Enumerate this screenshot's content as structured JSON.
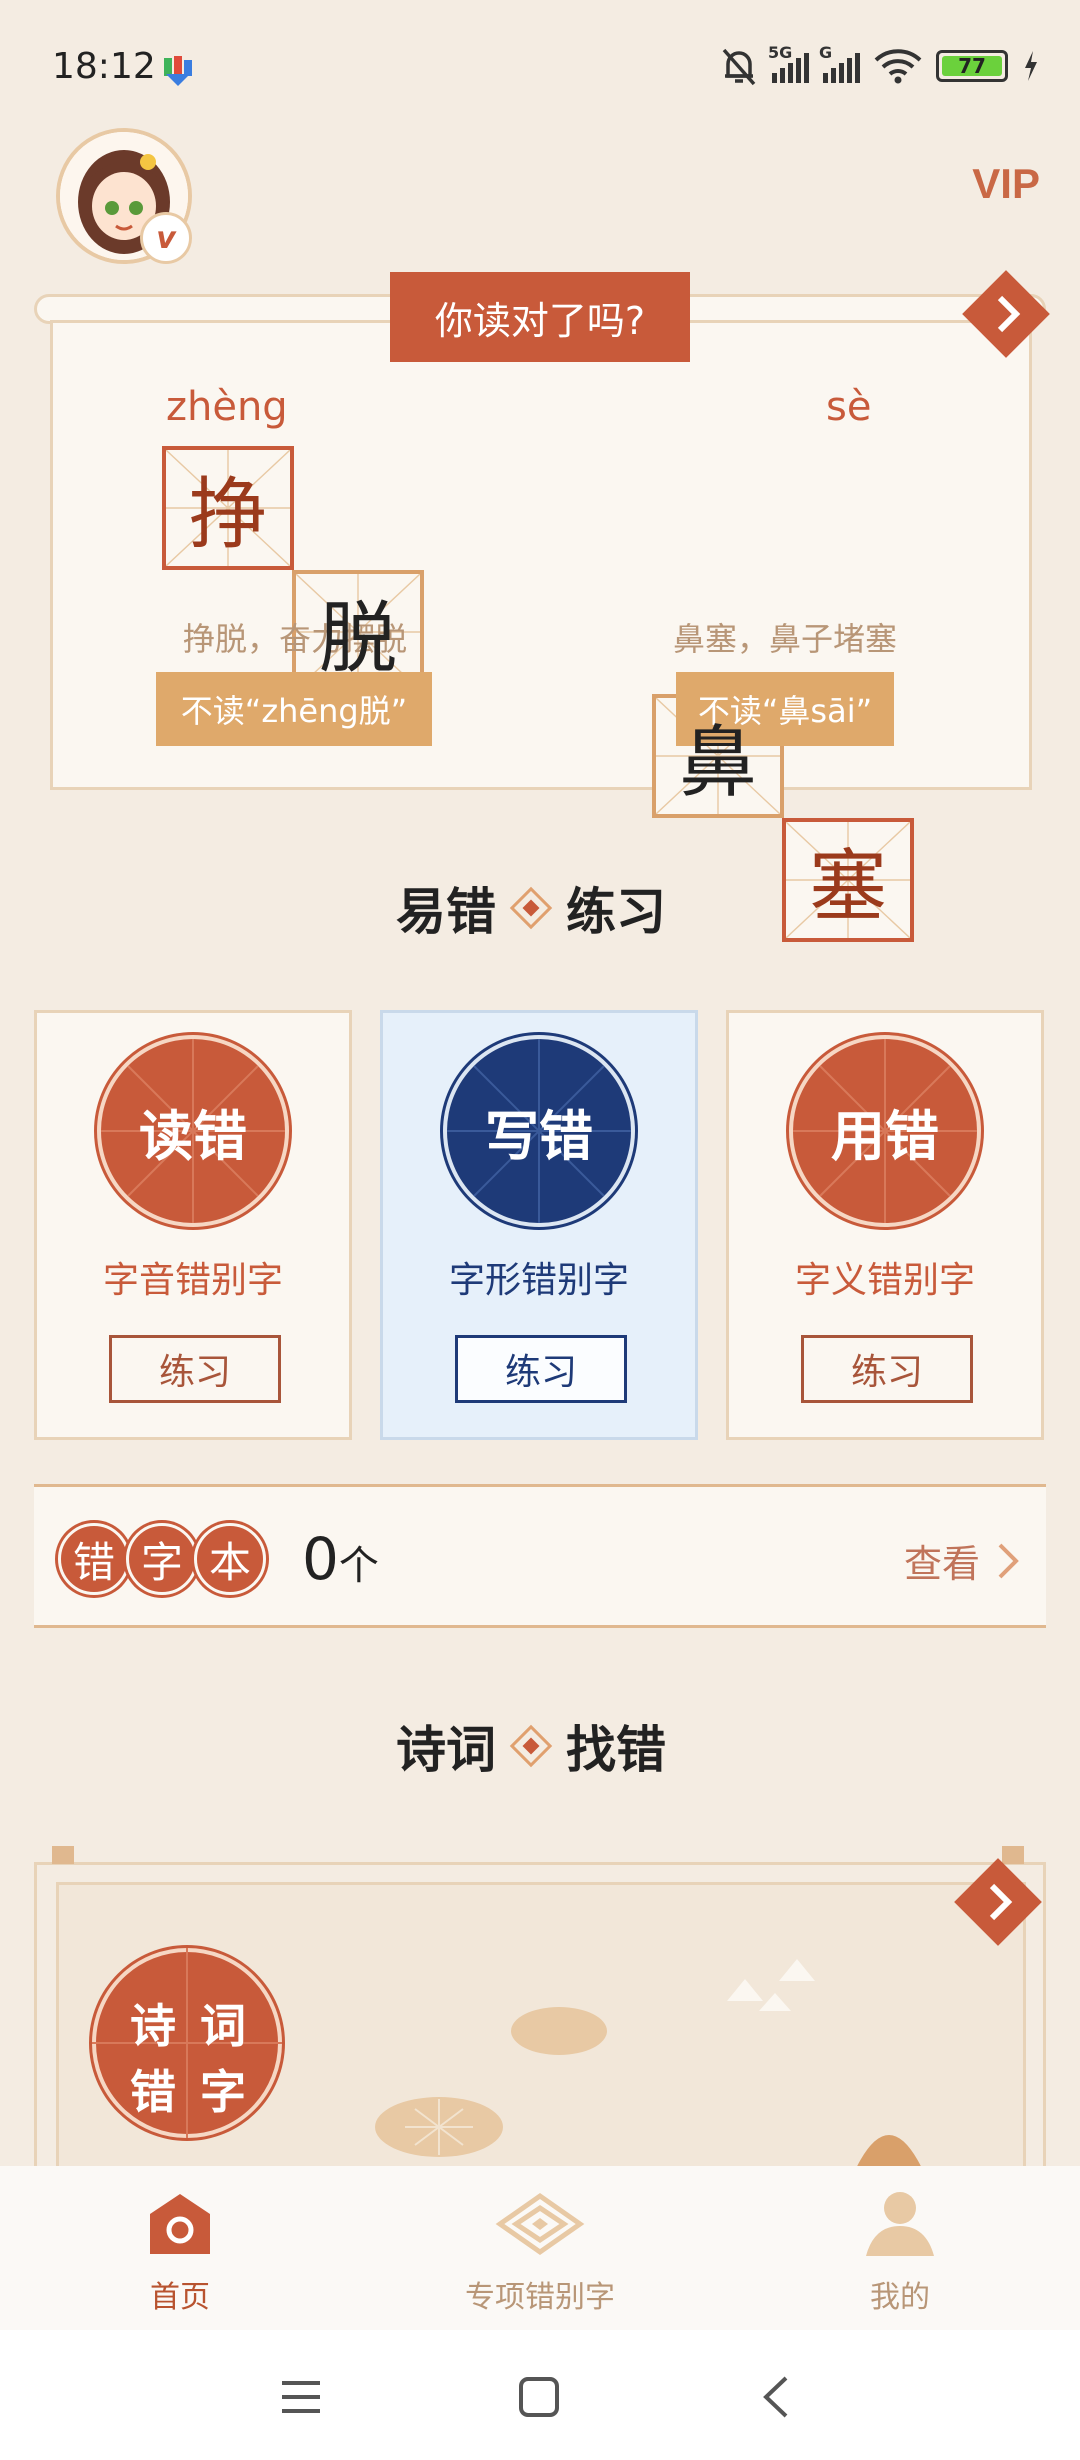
{
  "status": {
    "time": "18:12",
    "network": "5G",
    "battery": "77"
  },
  "header": {
    "vip": "VIP",
    "avatar_badge": "v"
  },
  "read_card": {
    "title": "你读对了吗?",
    "words": [
      {
        "pinyin": "zhèng",
        "chars": [
          "挣",
          "脱"
        ],
        "meaning": "挣脱，奋力摆脱",
        "not_read": "不读“zhēng脱”"
      },
      {
        "pinyin": "sè",
        "chars": [
          "鼻",
          "塞"
        ],
        "meaning": "鼻塞，鼻子堵塞",
        "not_read": "不读“鼻sāi”"
      }
    ]
  },
  "practice_section": {
    "title_left": "易错",
    "title_right": "练习",
    "cards": [
      {
        "circle": "读错",
        "label": "字音错别字",
        "button": "练习"
      },
      {
        "circle": "写错",
        "label": "字形错别字",
        "button": "练习"
      },
      {
        "circle": "用错",
        "label": "字义错别字",
        "button": "练习"
      }
    ]
  },
  "wrong_book": {
    "chips": [
      "错",
      "字",
      "本"
    ],
    "count": "0",
    "unit": "个",
    "view": "查看"
  },
  "poem_section": {
    "title_left": "诗词",
    "title_right": "找错",
    "circle_chars": [
      "诗",
      "词",
      "错",
      "字"
    ]
  },
  "bottom_nav": [
    {
      "label": "首页",
      "active": true
    },
    {
      "label": "专项错别字",
      "active": false
    },
    {
      "label": "我的",
      "active": false
    }
  ],
  "colors": {
    "accent": "#c85a3a",
    "navy": "#1e3a78",
    "gold": "#dfa96b",
    "background": "#f4ece2"
  }
}
